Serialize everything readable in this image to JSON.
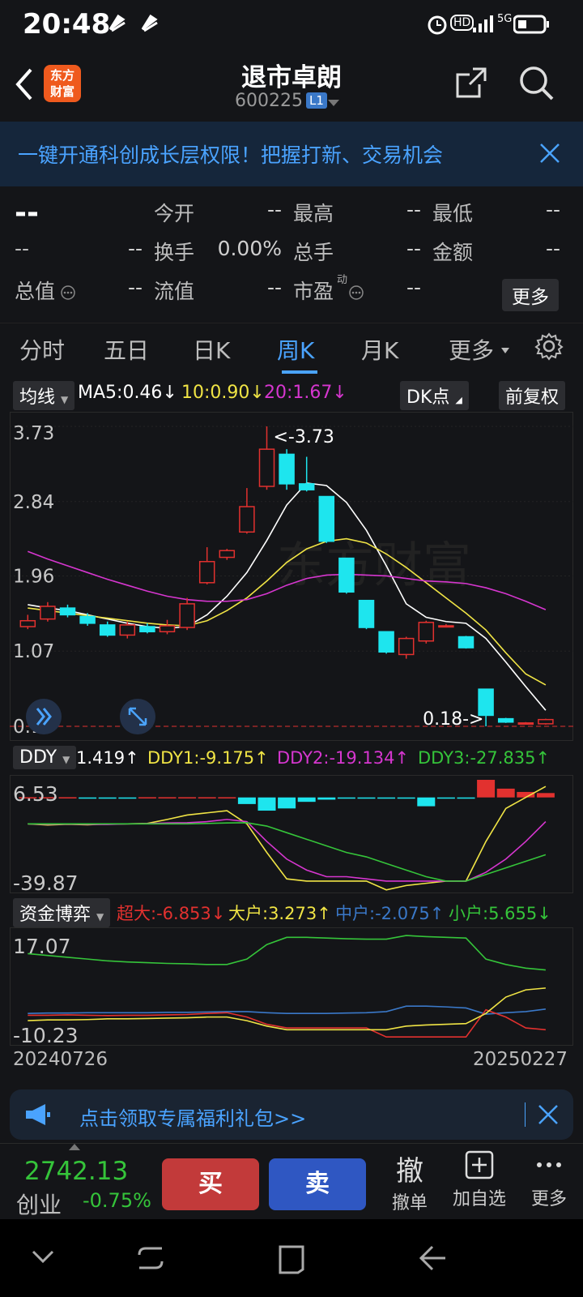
{
  "status_bar": {
    "time": "20:48",
    "net": "5G"
  },
  "header": {
    "logo_line1": "东方",
    "logo_line2": "财富",
    "title": "退市卓朗",
    "code": "600225",
    "level_badge": "L1"
  },
  "banner": {
    "text": "一键开通科创成长层权限！把握打新、交易机会"
  },
  "quote": {
    "price": "--",
    "change": "--",
    "change_pct": "--",
    "row1": [
      {
        "label": "今开",
        "value": "--"
      },
      {
        "label": "最高",
        "value": "--"
      },
      {
        "label": "最低",
        "value": "--"
      }
    ],
    "row2": [
      {
        "label": "换手",
        "value": "0.00%"
      },
      {
        "label": "总手",
        "value": "--"
      },
      {
        "label": "金额",
        "value": "--"
      }
    ],
    "row3": [
      {
        "label": "总值",
        "value": "--"
      },
      {
        "label": "流值",
        "value": "--"
      },
      {
        "label": "市盈",
        "value": "--",
        "sup": "动"
      }
    ],
    "more_label": "更多"
  },
  "tabs": [
    "分时",
    "五日",
    "日K",
    "周K",
    "月K",
    "更多"
  ],
  "active_tab": "周K",
  "kline_legend": {
    "type_label": "均线",
    "ma5": "MA5:0.46",
    "ma10": "10:0.90",
    "ma20": "20:1.67",
    "dk_label": "DK点",
    "adjust_label": "前复权"
  },
  "ddy_legend": {
    "name": "DDY",
    "ddy": "1.419",
    "ddy1": "DDY1:-9.175",
    "ddy2": "DDY2:-19.134",
    "ddy3": "DDY3:-27.835"
  },
  "fund_legend": {
    "name": "资金博弈",
    "super": "超大:-6.853",
    "big": "大户:3.273",
    "mid": "中户:-2.075",
    "small": "小户:5.655"
  },
  "date_range": {
    "start": "20240726",
    "end": "20250227"
  },
  "promo": {
    "text": "点击领取专属福利礼包>>"
  },
  "index": {
    "value": "2742.13",
    "name": "创业",
    "change_pct": "-0.75%"
  },
  "actions": {
    "buy": "买",
    "sell": "卖",
    "cancel_icon_char": "撤",
    "cancel": "撤单",
    "add_watch": "加自选",
    "more": "更多"
  },
  "colors": {
    "up": "#e2312f",
    "down": "#1ee5ee",
    "ma5": "#ffffff",
    "ma10": "#f0e445",
    "ma20": "#d636cf",
    "green": "#35c43a",
    "blue": "#3a78c8",
    "accent": "#4aa3ff"
  },
  "chart_data": [
    {
      "type": "candlestick",
      "title": "",
      "y_ticks": [
        "3.73",
        "2.84",
        "1.96",
        "1.07",
        "0.18"
      ],
      "ylim": [
        0.18,
        3.73
      ],
      "annotations": [
        "<-3.73",
        "0.18->"
      ],
      "candles": [
        {
          "o": 1.36,
          "c": 1.43,
          "h": 1.5,
          "l": 1.33
        },
        {
          "o": 1.45,
          "c": 1.6,
          "h": 1.65,
          "l": 1.42
        },
        {
          "o": 1.58,
          "c": 1.5,
          "h": 1.62,
          "l": 1.47
        },
        {
          "o": 1.48,
          "c": 1.4,
          "h": 1.52,
          "l": 1.37
        },
        {
          "o": 1.38,
          "c": 1.26,
          "h": 1.42,
          "l": 1.24
        },
        {
          "o": 1.26,
          "c": 1.38,
          "h": 1.42,
          "l": 1.22
        },
        {
          "o": 1.36,
          "c": 1.3,
          "h": 1.4,
          "l": 1.28
        },
        {
          "o": 1.3,
          "c": 1.37,
          "h": 1.44,
          "l": 1.27
        },
        {
          "o": 1.35,
          "c": 1.63,
          "h": 1.7,
          "l": 1.32
        },
        {
          "o": 1.88,
          "c": 2.13,
          "h": 2.3,
          "l": 1.86
        },
        {
          "o": 2.18,
          "c": 2.26,
          "h": 2.28,
          "l": 2.15
        },
        {
          "o": 2.48,
          "c": 2.78,
          "h": 3.0,
          "l": 2.46
        },
        {
          "o": 3.02,
          "c": 3.46,
          "h": 3.73,
          "l": 2.98
        },
        {
          "o": 3.4,
          "c": 3.05,
          "h": 3.46,
          "l": 2.98
        },
        {
          "o": 3.05,
          "c": 2.98,
          "h": 3.37,
          "l": 2.96
        },
        {
          "o": 2.9,
          "c": 2.37,
          "h": 2.9,
          "l": 2.35
        },
        {
          "o": 2.17,
          "c": 1.77,
          "h": 2.17,
          "l": 1.75
        },
        {
          "o": 1.67,
          "c": 1.35,
          "h": 1.67,
          "l": 1.33
        },
        {
          "o": 1.3,
          "c": 1.06,
          "h": 1.3,
          "l": 1.04
        },
        {
          "o": 1.03,
          "c": 1.22,
          "h": 1.24,
          "l": 0.98
        },
        {
          "o": 1.19,
          "c": 1.41,
          "h": 1.43,
          "l": 1.16
        },
        {
          "o": 1.37,
          "c": 1.37,
          "h": 1.39,
          "l": 1.35
        },
        {
          "o": 1.24,
          "c": 1.11,
          "h": 1.25,
          "l": 1.1
        },
        {
          "o": 0.62,
          "c": 0.31,
          "h": 0.62,
          "l": 0.18
        },
        {
          "o": 0.27,
          "c": 0.23,
          "h": 0.28,
          "l": 0.22
        },
        {
          "o": 0.21,
          "c": 0.22,
          "h": 0.23,
          "l": 0.2
        },
        {
          "o": 0.21,
          "c": 0.26,
          "h": 0.27,
          "l": 0.2
        }
      ],
      "series": [
        {
          "name": "MA5",
          "values": [
            1.62,
            1.58,
            1.55,
            1.5,
            1.45,
            1.4,
            1.36,
            1.34,
            1.36,
            1.5,
            1.72,
            2.0,
            2.38,
            2.8,
            3.06,
            3.03,
            2.83,
            2.5,
            2.08,
            1.63,
            1.47,
            1.42,
            1.4,
            1.22,
            0.94,
            0.65,
            0.37
          ]
        },
        {
          "name": "MA10",
          "values": [
            1.58,
            1.55,
            1.52,
            1.49,
            1.46,
            1.43,
            1.4,
            1.38,
            1.37,
            1.43,
            1.55,
            1.7,
            1.9,
            2.12,
            2.28,
            2.37,
            2.4,
            2.35,
            2.22,
            2.06,
            1.88,
            1.7,
            1.52,
            1.32,
            1.05,
            0.8,
            0.67
          ]
        },
        {
          "name": "MA20",
          "values": [
            2.25,
            2.16,
            2.08,
            2.0,
            1.92,
            1.85,
            1.78,
            1.72,
            1.68,
            1.66,
            1.66,
            1.68,
            1.75,
            1.85,
            1.93,
            1.97,
            1.98,
            1.97,
            1.96,
            1.93,
            1.9,
            1.89,
            1.87,
            1.82,
            1.75,
            1.66,
            1.56
          ]
        }
      ]
    },
    {
      "type": "bar+line",
      "title": "DDY",
      "y_ticks": [
        "6.53",
        "-39.87"
      ],
      "ylim": [
        -39.87,
        6.53
      ],
      "bars": [
        0.1,
        0.1,
        0.1,
        -0.5,
        -0.5,
        -0.3,
        0.1,
        0.1,
        0.1,
        0.1,
        0.1,
        -3.0,
        -6.0,
        -5.0,
        -2.0,
        -1.0,
        -0.5,
        -0.3,
        -0.3,
        -0.3,
        -4.0,
        -0.3,
        -0.3,
        8.0,
        4.0,
        2.5,
        2.0
      ],
      "series": [
        {
          "name": "DDY1",
          "values": [
            -12,
            -12.5,
            -12.2,
            -12.4,
            -12.1,
            -12,
            -11.8,
            -10,
            -8,
            -7,
            -6,
            -12,
            -25,
            -37,
            -38,
            -38,
            -38,
            -38,
            -42,
            -40,
            -39,
            -38,
            -38,
            -20,
            -5,
            0,
            5
          ]
        },
        {
          "name": "DDY2",
          "values": [
            -12,
            -12.2,
            -12.1,
            -12.2,
            -12.3,
            -12,
            -11.9,
            -11.6,
            -11.5,
            -11,
            -10,
            -11,
            -20,
            -28,
            -33,
            -36,
            -36,
            -37,
            -38,
            -38,
            -38,
            -38,
            -38,
            -34,
            -28,
            -20,
            -11
          ]
        },
        {
          "name": "DDY3",
          "values": [
            -12,
            -12,
            -12,
            -12,
            -12,
            -12,
            -12,
            -12,
            -12,
            -11.8,
            -11.6,
            -11.5,
            -13,
            -16,
            -19,
            -22,
            -25,
            -27,
            -30,
            -33,
            -36,
            -38,
            -38,
            -35,
            -32,
            -29,
            -26
          ]
        }
      ]
    },
    {
      "type": "line",
      "title": "资金博弈",
      "y_ticks": [
        "17.07",
        "-10.23"
      ],
      "ylim": [
        -10.23,
        17.07
      ],
      "series": [
        {
          "name": "小户",
          "values": [
            12.5,
            12.0,
            11.5,
            11.0,
            10.5,
            10.2,
            10.0,
            9.8,
            9.7,
            9.5,
            9.5,
            11.0,
            15.0,
            17.0,
            17.0,
            16.8,
            16.6,
            16.5,
            16.5,
            17.5,
            17.2,
            17.0,
            16.8,
            11.0,
            9.5,
            8.5,
            8.0
          ]
        },
        {
          "name": "中户",
          "values": [
            -4.0,
            -3.9,
            -3.9,
            -3.8,
            -3.8,
            -3.8,
            -3.8,
            -3.7,
            -3.7,
            -3.6,
            -3.5,
            -3.5,
            -3.8,
            -4.0,
            -4.0,
            -4.0,
            -3.9,
            -3.8,
            -3.5,
            -2.0,
            -2.0,
            -2.2,
            -2.5,
            -4.2,
            -3.8,
            -3.5,
            -2.8
          ]
        },
        {
          "name": "超大",
          "values": [
            -4.5,
            -4.5,
            -4.4,
            -4.5,
            -4.6,
            -4.5,
            -4.5,
            -4.4,
            -4.3,
            -4.0,
            -3.8,
            -5.0,
            -7.0,
            -8.0,
            -8.0,
            -8.0,
            -8.0,
            -8.0,
            -10.5,
            -10.5,
            -10.5,
            -10.5,
            -10.5,
            -3.0,
            -5.0,
            -8.0,
            -8.5
          ]
        },
        {
          "name": "大户",
          "values": [
            -6.0,
            -5.8,
            -5.8,
            -5.7,
            -5.5,
            -5.5,
            -5.4,
            -5.3,
            -5.2,
            -5.0,
            -5.0,
            -6.0,
            -7.5,
            -8.5,
            -8.5,
            -8.5,
            -8.5,
            -8.5,
            -8.5,
            -7.5,
            -7.2,
            -7.0,
            -6.8,
            -4.0,
            0.5,
            2.5,
            3.0
          ]
        }
      ]
    }
  ]
}
